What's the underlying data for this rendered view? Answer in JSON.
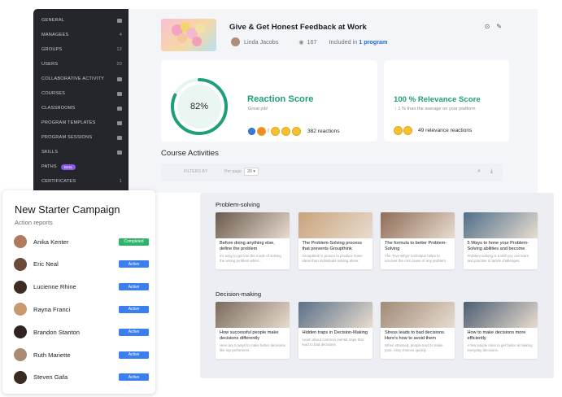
{
  "sidebar": {
    "items": [
      {
        "label": "GENERAL",
        "count": "",
        "icon": "bar-chart-icon",
        "badge": ""
      },
      {
        "label": "MANAGEES",
        "count": "4",
        "icon": "",
        "badge": ""
      },
      {
        "label": "GROUPS",
        "count": "12",
        "icon": "",
        "badge": ""
      },
      {
        "label": "USERS",
        "count": "20",
        "icon": "",
        "badge": ""
      },
      {
        "label": "COLLABORATIVE ACTIVITY",
        "count": "",
        "icon": "trend-icon",
        "badge": ""
      },
      {
        "label": "COURSES",
        "count": "",
        "icon": "courses-icon",
        "badge": ""
      },
      {
        "label": "CLASSROOMS",
        "count": "",
        "icon": "classroom-icon",
        "badge": ""
      },
      {
        "label": "PROGRAM TEMPLATES",
        "count": "",
        "icon": "template-icon",
        "badge": ""
      },
      {
        "label": "PROGRAM SESSIONS",
        "count": "",
        "icon": "calendar-icon",
        "badge": ""
      },
      {
        "label": "SKILLS",
        "count": "",
        "icon": "skills-icon",
        "badge": ""
      },
      {
        "label": "PATHS",
        "count": "",
        "icon": "",
        "badge": "Beta"
      },
      {
        "label": "CERTIFICATES",
        "count": "1",
        "icon": "",
        "badge": ""
      }
    ]
  },
  "course": {
    "title": "Give & Get Honest Feedback at Work",
    "author": "Linda Jacobs",
    "views": "167",
    "included_prefix": "Included in",
    "included_link": "1 program"
  },
  "reaction": {
    "percent": 82,
    "percent_label": "82%",
    "title": "Reaction Score",
    "subtitle": "Great job!",
    "reactions": "382 reactions",
    "color": "#1f9e7b"
  },
  "relevance": {
    "title": "100 % Relevance Score",
    "subtitle": "↑ 1 % than the average on your platform",
    "reactions": "49 relevance reactions"
  },
  "activities": {
    "title": "Course Activities",
    "filter_label": "Filters by",
    "per_page_label": "Per page",
    "per_page_value": "20"
  },
  "campaign": {
    "title": "New Starter Campaign",
    "subtitle": "Action reports",
    "rows": [
      {
        "name": "Anika Kenter",
        "status": "Completed",
        "kind": "completed",
        "avatar": "#b07a5c"
      },
      {
        "name": "Eric Neal",
        "status": "Active",
        "kind": "active",
        "avatar": "#6b4a3a"
      },
      {
        "name": "Lucienne Rhine",
        "status": "Active",
        "kind": "active",
        "avatar": "#3e2b22"
      },
      {
        "name": "Rayna Franci",
        "status": "Active",
        "kind": "active",
        "avatar": "#c99a70"
      },
      {
        "name": "Brandon Stanton",
        "status": "Active",
        "kind": "active",
        "avatar": "#2f2420"
      },
      {
        "name": "Ruth Mariette",
        "status": "Active",
        "kind": "active",
        "avatar": "#a98a72"
      },
      {
        "name": "Steven Gafa",
        "status": "Active",
        "kind": "active",
        "avatar": "#3a2a22"
      }
    ]
  },
  "library": {
    "sections": [
      {
        "title": "Problem-solving",
        "tiles": [
          {
            "title": "Before doing anything else, define the problem",
            "desc": "It's easy to get into the mode of solving the wrong problem when...",
            "img": "#6b5a4e"
          },
          {
            "title": "The Problem-Solving process that prevents Groupthink",
            "desc": "Groupthink is proven to produce fewer ideas than individuals solving alone.",
            "img": "#c9a27a"
          },
          {
            "title": "The formula to better Problem-Solving",
            "desc": "The 'Five Whys' technique helps to uncover the root cause of any problem.",
            "img": "#8f6c58"
          },
          {
            "title": "5 Ways to hone your Problem-Solving abilities and become",
            "desc": "Problem-solving is a skill you can learn and practise to tackle challenges.",
            "img": "#4f6f8a"
          }
        ]
      },
      {
        "title": "Decision-making",
        "tiles": [
          {
            "title": "How successful people make decisions differently",
            "desc": "Here are 5 ways to make better decisions like top performers.",
            "img": "#7a6a5c"
          },
          {
            "title": "Hidden traps in Decision-Making",
            "desc": "Learn about common mental traps that lead to bad decisions.",
            "img": "#5a7088"
          },
          {
            "title": "Stress leads to bad decisions. Here's how to avoid them",
            "desc": "When stressed, people tend to make poor, risky choices quickly.",
            "img": "#a08a78"
          },
          {
            "title": "How to make decisions more efficiently",
            "desc": "A few simple rules to get faster at making everyday decisions.",
            "img": "#4c5e72"
          }
        ]
      }
    ]
  }
}
